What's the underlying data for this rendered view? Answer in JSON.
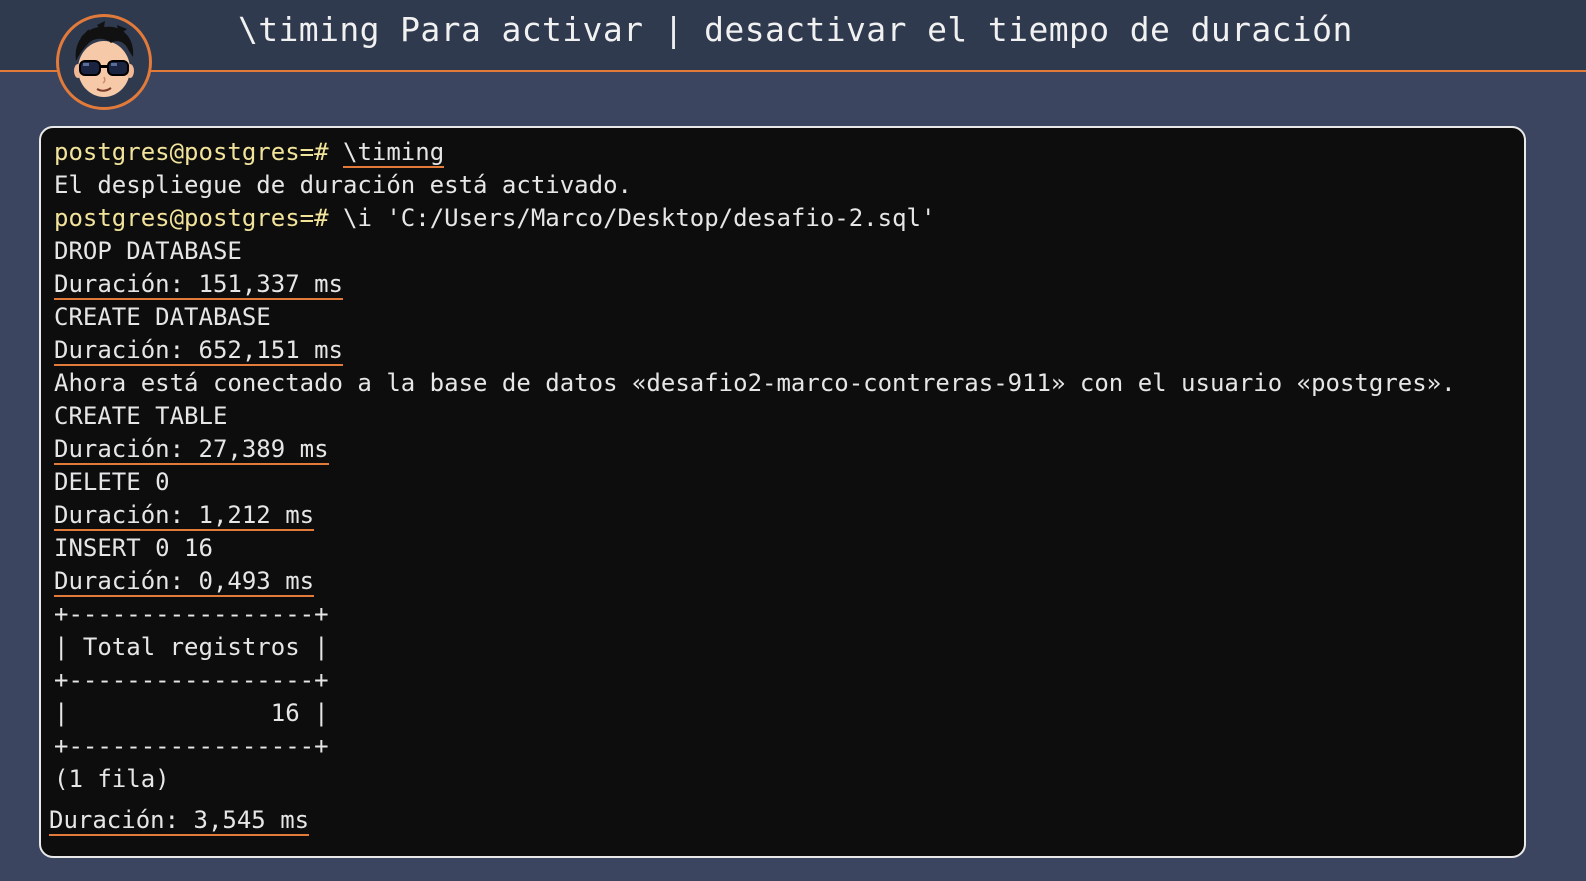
{
  "header": {
    "title": "\\timing Para activar | desactivar el tiempo de duración"
  },
  "colors": {
    "background": "#3b4560",
    "header_bar": "#2f3a4f",
    "accent": "#e27a3a",
    "terminal_bg": "#0d0d0d",
    "prompt": "#f2e39b",
    "text": "#e6e6e6"
  },
  "terminal": {
    "prompt": "postgres@postgres=#",
    "cmd1": "\\timing",
    "out1": "El despliegue de duración está activado.",
    "cmd2": "\\i 'C:/Users/Marco/Desktop/desafio-2.sql'",
    "drop_db": "DROP DATABASE",
    "dur_drop": "Duración: 151,337 ms",
    "create_db": "CREATE DATABASE",
    "dur_create_db": "Duración: 652,151 ms",
    "connected": "Ahora está conectado a la base de datos «desafio2-marco-contreras-911» con el usuario «postgres».",
    "create_table": "CREATE TABLE",
    "dur_create_table": "Duración: 27,389 ms",
    "delete": "DELETE 0",
    "dur_delete": "Duración: 1,212 ms",
    "insert": "INSERT 0 16",
    "dur_insert": "Duración: 0,493 ms",
    "table_border": "+-----------------+",
    "table_header": "| Total registros |",
    "table_value": "|              16 |",
    "rows": "(1 fila)",
    "dur_select": "Duración: 3,545 ms"
  }
}
